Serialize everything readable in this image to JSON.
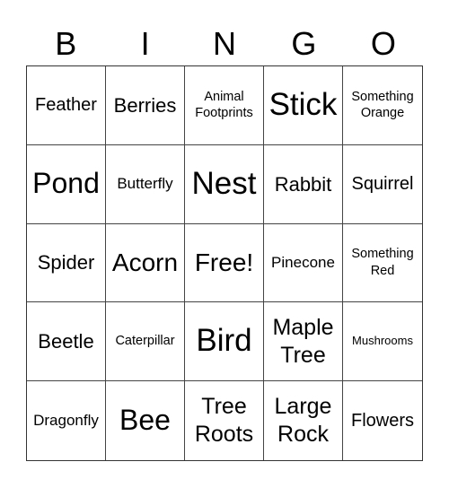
{
  "header": [
    "B",
    "I",
    "N",
    "G",
    "O"
  ],
  "cells": [
    "Feather",
    "Berries",
    "Animal Footprints",
    "Stick",
    "Something Orange",
    "Pond",
    "Butterfly",
    "Nest",
    "Rabbit",
    "Squirrel",
    "Spider",
    "Acorn",
    "Free!",
    "Pinecone",
    "Something Red",
    "Beetle",
    "Caterpillar",
    "Bird",
    "Maple Tree",
    "Mushrooms",
    "Dragonfly",
    "Bee",
    "Tree Roots",
    "Large Rock",
    "Flowers"
  ],
  "free_space": "Free!"
}
